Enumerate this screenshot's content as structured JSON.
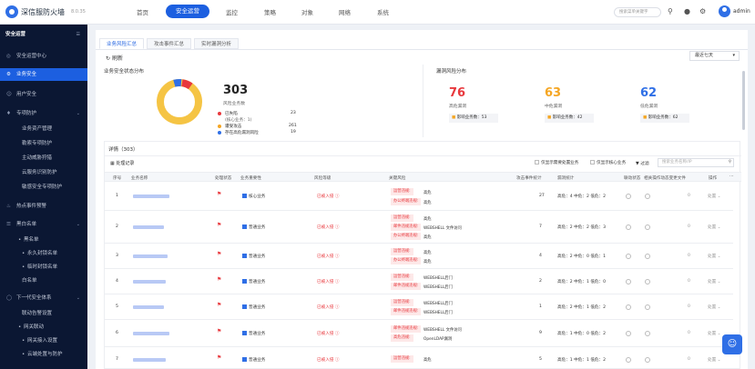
{
  "app": {
    "brand": "深信服防火墙",
    "version": "8.0.35",
    "user": "admin"
  },
  "nav": [
    {
      "label": "首页"
    },
    {
      "label": "安全运营",
      "active": true
    },
    {
      "label": "监控"
    },
    {
      "label": "策略"
    },
    {
      "label": "对象"
    },
    {
      "label": "网络"
    },
    {
      "label": "系统"
    }
  ],
  "search_placeholder": "搜索菜单关键字",
  "sidebar": {
    "header": "安全运营",
    "items": [
      {
        "label": "安全运营中心",
        "icon": "target-icon"
      },
      {
        "label": "业务安全",
        "icon": "gear-icon",
        "active": true
      },
      {
        "label": "用户安全",
        "icon": "user-icon"
      },
      {
        "label": "专项防护",
        "icon": "shield-icon",
        "expand": true
      },
      {
        "label": "业务资产管理",
        "sub": true
      },
      {
        "label": "勒索专项防护",
        "sub": true
      },
      {
        "label": "主动威胁狩猎",
        "sub": true
      },
      {
        "label": "云服务识别防护",
        "sub": true
      },
      {
        "label": "敏感安全专项防护",
        "sub": true
      },
      {
        "label": "热点事件预警",
        "icon": "fire-icon"
      },
      {
        "label": "黑白名单",
        "icon": "list-icon",
        "expand": true
      },
      {
        "label": "黑名单",
        "sub": true,
        "dot": true
      },
      {
        "label": "永久封锁名单",
        "sub2": true
      },
      {
        "label": "临时封锁名单",
        "sub2": true
      },
      {
        "label": "白名单",
        "sub": true
      },
      {
        "label": "下一代安全体系",
        "icon": "cycle-icon",
        "expand": true
      },
      {
        "label": "联动告警设置",
        "sub": true
      },
      {
        "label": "网关联动",
        "sub": true,
        "dot": true
      },
      {
        "label": "网关接入设置",
        "sub2": true
      },
      {
        "label": "云端处置与防护",
        "sub2": true
      }
    ]
  },
  "tabs": [
    {
      "label": "业务风险汇总",
      "active": true
    },
    {
      "label": "攻击事件汇总"
    },
    {
      "label": "实时漏洞分析"
    }
  ],
  "refresh_label": "刷新",
  "time_range": "最近七天",
  "status_panel": {
    "title": "业务安全状态分布",
    "total": "303",
    "total_label": "风险业务数",
    "legend": [
      {
        "label": "已失陷",
        "value": "23",
        "color": "#e8383d"
      },
      {
        "label": "(核心业务：1)",
        "value": "",
        "color": ""
      },
      {
        "label": "遭受攻击",
        "value": "261",
        "color": "#f5a623"
      },
      {
        "label": "存在高危漏洞风险",
        "value": "19",
        "color": "#2f6fe6"
      }
    ]
  },
  "vuln_panel": {
    "title": "漏洞风险分布",
    "items": [
      {
        "value": "76",
        "label": "高危漏洞",
        "affected": "影响业务数：53",
        "color": "#e8383d"
      },
      {
        "value": "63",
        "label": "中危漏洞",
        "affected": "影响业务数：42",
        "color": "#f5a623"
      },
      {
        "value": "62",
        "label": "低危漏洞",
        "affected": "影响业务数：62",
        "color": "#2f6fe6"
      }
    ]
  },
  "detail": {
    "title": "详情（303）",
    "handle_label": "处理记录",
    "filter_unprocessed": "仅显示需要处置业务",
    "filter_core": "仅显示核心业务",
    "filter_label": "过滤",
    "search_placeholder": "搜索业务名称/IP",
    "columns": [
      "序号",
      "业务名称",
      "处理状态",
      "业务重要性",
      "风险等级",
      "关键风险",
      "攻击事件统计",
      "漏洞统计",
      "联动状态",
      "相关操作动态变更文件",
      "操作"
    ],
    "rows": [
      {
        "no": "1",
        "importance": "核心业务",
        "risk": "已被入侵",
        "tags": [
          [
            "运营违规:",
            "高危"
          ],
          [
            "办公终端违规:",
            "高危"
          ]
        ],
        "attacks": "27",
        "vuln": "高危：4  中危：2  低危：2",
        "action": "处置"
      },
      {
        "no": "2",
        "importance": "普通业务",
        "risk": "已被入侵",
        "tags": [
          [
            "运营违规:",
            "高危"
          ],
          [
            "邮件违规违规:",
            "WEBSHELL 文件访问"
          ],
          [
            "办公终端违规:",
            "高危"
          ]
        ],
        "attacks": "7",
        "vuln": "高危：2  中危：2  低危：3",
        "action": "处置"
      },
      {
        "no": "3",
        "importance": "普通业务",
        "risk": "已被入侵",
        "tags": [
          [
            "运营违规:",
            "高危"
          ],
          [
            "办公终端违规:",
            "高危"
          ]
        ],
        "attacks": "4",
        "vuln": "高危：2  中危：0  低危：1",
        "action": "处置"
      },
      {
        "no": "4",
        "importance": "普通业务",
        "risk": "已被入侵",
        "tags": [
          [
            "运营违规:",
            "WEBSHELL后门"
          ],
          [
            "邮件违规违规:",
            "WEBSHELL后门"
          ]
        ],
        "attacks": "2",
        "vuln": "高危：2  中危：1  低危：0",
        "action": "处置"
      },
      {
        "no": "5",
        "importance": "普通业务",
        "risk": "已被入侵",
        "tags": [
          [
            "运营违规:",
            "WEBSHELL后门"
          ],
          [
            "邮件违规违规:",
            "WEBSHELL后门"
          ]
        ],
        "attacks": "1",
        "vuln": "高危：2  中危：1  低危：2",
        "action": "处置"
      },
      {
        "no": "6",
        "importance": "普通业务",
        "risk": "已被入侵",
        "tags": [
          [
            "邮件违规违规:",
            "WEBSHELL 文件访问"
          ],
          [
            "高危违规:",
            "OpenLDAP漏洞"
          ]
        ],
        "attacks": "9",
        "vuln": "高危：1  中危：0  低危：2",
        "action": "处置"
      },
      {
        "no": "7",
        "importance": "普通业务",
        "risk": "已被入侵",
        "tags": [
          [
            "运营违规:",
            "高危"
          ]
        ],
        "attacks": "5",
        "vuln": "高危：1  中危：1  低危：2",
        "action": "处置"
      }
    ]
  },
  "colors": {
    "accent": "#1c5fe0",
    "sidebar": "#0b1733",
    "danger": "#e8383d",
    "warning": "#f5a623"
  }
}
